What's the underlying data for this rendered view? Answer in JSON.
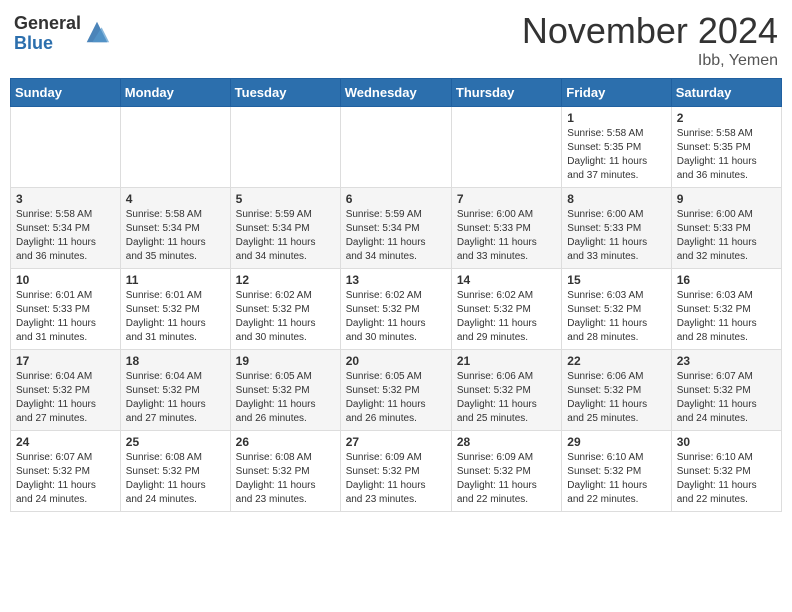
{
  "header": {
    "logo_general": "General",
    "logo_blue": "Blue",
    "month_title": "November 2024",
    "location": "Ibb, Yemen"
  },
  "days_of_week": [
    "Sunday",
    "Monday",
    "Tuesday",
    "Wednesday",
    "Thursday",
    "Friday",
    "Saturday"
  ],
  "weeks": [
    [
      {
        "day": "",
        "info": ""
      },
      {
        "day": "",
        "info": ""
      },
      {
        "day": "",
        "info": ""
      },
      {
        "day": "",
        "info": ""
      },
      {
        "day": "",
        "info": ""
      },
      {
        "day": "1",
        "info": "Sunrise: 5:58 AM\nSunset: 5:35 PM\nDaylight: 11 hours\nand 37 minutes."
      },
      {
        "day": "2",
        "info": "Sunrise: 5:58 AM\nSunset: 5:35 PM\nDaylight: 11 hours\nand 36 minutes."
      }
    ],
    [
      {
        "day": "3",
        "info": "Sunrise: 5:58 AM\nSunset: 5:34 PM\nDaylight: 11 hours\nand 36 minutes."
      },
      {
        "day": "4",
        "info": "Sunrise: 5:58 AM\nSunset: 5:34 PM\nDaylight: 11 hours\nand 35 minutes."
      },
      {
        "day": "5",
        "info": "Sunrise: 5:59 AM\nSunset: 5:34 PM\nDaylight: 11 hours\nand 34 minutes."
      },
      {
        "day": "6",
        "info": "Sunrise: 5:59 AM\nSunset: 5:34 PM\nDaylight: 11 hours\nand 34 minutes."
      },
      {
        "day": "7",
        "info": "Sunrise: 6:00 AM\nSunset: 5:33 PM\nDaylight: 11 hours\nand 33 minutes."
      },
      {
        "day": "8",
        "info": "Sunrise: 6:00 AM\nSunset: 5:33 PM\nDaylight: 11 hours\nand 33 minutes."
      },
      {
        "day": "9",
        "info": "Sunrise: 6:00 AM\nSunset: 5:33 PM\nDaylight: 11 hours\nand 32 minutes."
      }
    ],
    [
      {
        "day": "10",
        "info": "Sunrise: 6:01 AM\nSunset: 5:33 PM\nDaylight: 11 hours\nand 31 minutes."
      },
      {
        "day": "11",
        "info": "Sunrise: 6:01 AM\nSunset: 5:32 PM\nDaylight: 11 hours\nand 31 minutes."
      },
      {
        "day": "12",
        "info": "Sunrise: 6:02 AM\nSunset: 5:32 PM\nDaylight: 11 hours\nand 30 minutes."
      },
      {
        "day": "13",
        "info": "Sunrise: 6:02 AM\nSunset: 5:32 PM\nDaylight: 11 hours\nand 30 minutes."
      },
      {
        "day": "14",
        "info": "Sunrise: 6:02 AM\nSunset: 5:32 PM\nDaylight: 11 hours\nand 29 minutes."
      },
      {
        "day": "15",
        "info": "Sunrise: 6:03 AM\nSunset: 5:32 PM\nDaylight: 11 hours\nand 28 minutes."
      },
      {
        "day": "16",
        "info": "Sunrise: 6:03 AM\nSunset: 5:32 PM\nDaylight: 11 hours\nand 28 minutes."
      }
    ],
    [
      {
        "day": "17",
        "info": "Sunrise: 6:04 AM\nSunset: 5:32 PM\nDaylight: 11 hours\nand 27 minutes."
      },
      {
        "day": "18",
        "info": "Sunrise: 6:04 AM\nSunset: 5:32 PM\nDaylight: 11 hours\nand 27 minutes."
      },
      {
        "day": "19",
        "info": "Sunrise: 6:05 AM\nSunset: 5:32 PM\nDaylight: 11 hours\nand 26 minutes."
      },
      {
        "day": "20",
        "info": "Sunrise: 6:05 AM\nSunset: 5:32 PM\nDaylight: 11 hours\nand 26 minutes."
      },
      {
        "day": "21",
        "info": "Sunrise: 6:06 AM\nSunset: 5:32 PM\nDaylight: 11 hours\nand 25 minutes."
      },
      {
        "day": "22",
        "info": "Sunrise: 6:06 AM\nSunset: 5:32 PM\nDaylight: 11 hours\nand 25 minutes."
      },
      {
        "day": "23",
        "info": "Sunrise: 6:07 AM\nSunset: 5:32 PM\nDaylight: 11 hours\nand 24 minutes."
      }
    ],
    [
      {
        "day": "24",
        "info": "Sunrise: 6:07 AM\nSunset: 5:32 PM\nDaylight: 11 hours\nand 24 minutes."
      },
      {
        "day": "25",
        "info": "Sunrise: 6:08 AM\nSunset: 5:32 PM\nDaylight: 11 hours\nand 24 minutes."
      },
      {
        "day": "26",
        "info": "Sunrise: 6:08 AM\nSunset: 5:32 PM\nDaylight: 11 hours\nand 23 minutes."
      },
      {
        "day": "27",
        "info": "Sunrise: 6:09 AM\nSunset: 5:32 PM\nDaylight: 11 hours\nand 23 minutes."
      },
      {
        "day": "28",
        "info": "Sunrise: 6:09 AM\nSunset: 5:32 PM\nDaylight: 11 hours\nand 22 minutes."
      },
      {
        "day": "29",
        "info": "Sunrise: 6:10 AM\nSunset: 5:32 PM\nDaylight: 11 hours\nand 22 minutes."
      },
      {
        "day": "30",
        "info": "Sunrise: 6:10 AM\nSunset: 5:32 PM\nDaylight: 11 hours\nand 22 minutes."
      }
    ]
  ]
}
